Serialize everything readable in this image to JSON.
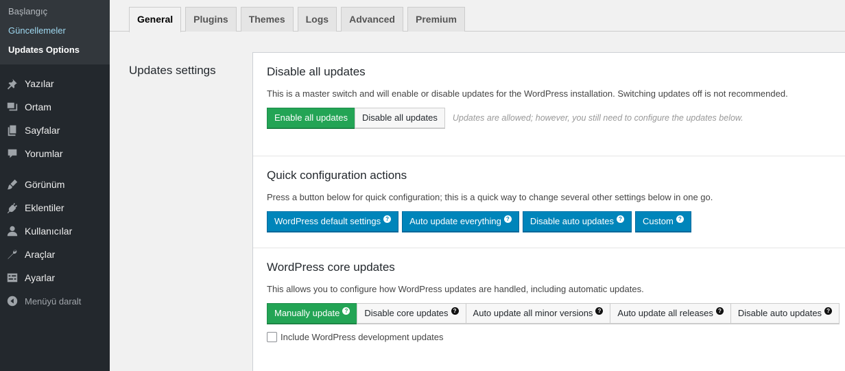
{
  "sidebar": {
    "submenu": [
      {
        "label": "Başlangıç"
      },
      {
        "label": "Güncellemeler"
      },
      {
        "label": "Updates Options"
      }
    ],
    "menu": [
      {
        "label": "Yazılar",
        "icon": "pin-icon"
      },
      {
        "label": "Ortam",
        "icon": "media-icon"
      },
      {
        "label": "Sayfalar",
        "icon": "pages-icon"
      },
      {
        "label": "Yorumlar",
        "icon": "comments-icon"
      },
      {
        "label": "Görünüm",
        "icon": "appearance-icon"
      },
      {
        "label": "Eklentiler",
        "icon": "plugins-icon"
      },
      {
        "label": "Kullanıcılar",
        "icon": "users-icon"
      },
      {
        "label": "Araçlar",
        "icon": "tools-icon"
      },
      {
        "label": "Ayarlar",
        "icon": "settings-icon"
      },
      {
        "label": "Menüyü daralt",
        "icon": "collapse-icon"
      }
    ]
  },
  "tabs": [
    {
      "label": "General",
      "active": true
    },
    {
      "label": "Plugins"
    },
    {
      "label": "Themes"
    },
    {
      "label": "Logs"
    },
    {
      "label": "Advanced"
    },
    {
      "label": "Premium"
    }
  ],
  "main": {
    "section_title": "Updates settings",
    "disable_all": {
      "title": "Disable all updates",
      "description": "This is a master switch and will enable or disable updates for the WordPress installation. Switching updates off is not recommended.",
      "enable_label": "Enable all updates",
      "disable_label": "Disable all updates",
      "hint": "Updates are allowed; however, you still need to configure the updates below."
    },
    "quick_config": {
      "title": "Quick configuration actions",
      "description": "Press a button below for quick configuration; this is a quick way to change several other settings below in one go.",
      "buttons": [
        {
          "label": "WordPress default settings"
        },
        {
          "label": "Auto update everything"
        },
        {
          "label": "Disable auto updates"
        },
        {
          "label": "Custom"
        }
      ]
    },
    "core_updates": {
      "title": "WordPress core updates",
      "description": "This allows you to configure how WordPress updates are handled, including automatic updates.",
      "options": [
        {
          "label": "Manually update",
          "selected": true
        },
        {
          "label": "Disable core updates"
        },
        {
          "label": "Auto update all minor versions"
        },
        {
          "label": "Auto update all releases"
        },
        {
          "label": "Disable auto updates"
        }
      ],
      "dev_updates_label": "Include WordPress development updates",
      "dev_updates_checked": false
    },
    "help_glyph": "?"
  },
  "colors": {
    "sidebar_bg": "#23282d",
    "submenu_bg": "#32373c",
    "green": "#23a455",
    "blue": "#0085ba"
  }
}
